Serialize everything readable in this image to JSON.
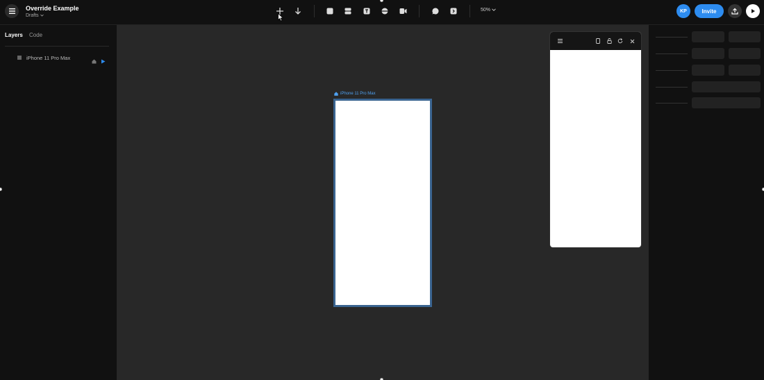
{
  "project": {
    "title": "Override Example",
    "subtitle": "Drafts"
  },
  "toolbar": {
    "zoom": "50%"
  },
  "user": {
    "initials": "KP"
  },
  "actions": {
    "invite_label": "Invite"
  },
  "left_panel": {
    "tabs": [
      {
        "label": "Layers"
      },
      {
        "label": "Code"
      }
    ],
    "layers": [
      {
        "name": "iPhone 11 Pro Max"
      }
    ]
  },
  "canvas": {
    "frame_label": "iPhone 11 Pro Max"
  },
  "colors": {
    "accent": "#2d8cf0",
    "frame_border": "#3a6490",
    "canvas_bg": "#282828",
    "panel_bg": "#111111"
  },
  "icons": [
    "menu-icon",
    "add-icon",
    "arrow-down-icon",
    "frame-icon",
    "stack-icon",
    "text-icon",
    "component-icon",
    "video-icon",
    "comment-icon",
    "code-icon",
    "chevron-down-icon",
    "publish-icon",
    "play-icon",
    "home-icon",
    "device-icon",
    "lock-icon",
    "refresh-icon",
    "close-icon"
  ]
}
